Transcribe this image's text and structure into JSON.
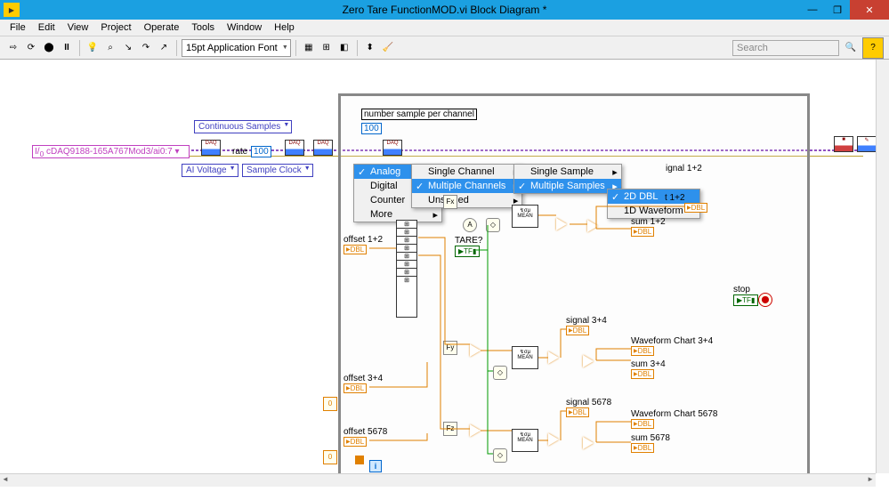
{
  "window": {
    "title": "Zero Tare FunctionMOD.vi Block Diagram *",
    "minimize": "—",
    "maximize": "❐",
    "close": "✕"
  },
  "menu": [
    "File",
    "Edit",
    "View",
    "Project",
    "Operate",
    "Tools",
    "Window",
    "Help"
  ],
  "toolbar": {
    "font_label": "15pt Application Font",
    "search_placeholder": "Search"
  },
  "diagram": {
    "device_path": "cDAQ9188-165A767Mod3/ai0:7",
    "continuous_samples": "Continuous Samples",
    "ai_voltage": "AI Voltage",
    "sample_clock": "Sample Clock",
    "rate_label": "rate",
    "rate_value": "100",
    "num_samples_label": "number sample per channel",
    "num_samples_value": "100",
    "tare_label": "TARE?",
    "tare_val": "TF",
    "stop_label": "stop",
    "stop_val": "TF",
    "fx": "Fx",
    "fy": "Fy",
    "fz": "Fz",
    "mean": "MEAN",
    "i_terminal": "i",
    "shift_zero": "0",
    "offsets": {
      "o12": "offset 1+2",
      "o34": "offset 3+4",
      "o5678": "offset 5678"
    },
    "signals": {
      "s12": "ignal 1+2",
      "s34": "signal 3+4",
      "s5678": "signal 5678"
    },
    "sums": {
      "sum12": "sum 1+2",
      "sum34": "sum 3+4",
      "sum5678": "sum 5678"
    },
    "charts": {
      "c12": "t 1+2",
      "c34": "Waveform Chart 3+4",
      "c5678": "Waveform Chart 5678"
    },
    "dbl": "DBL",
    "daq": "DAQ"
  },
  "context_menu": {
    "col1": [
      {
        "label": "Analog",
        "arrow": true,
        "sel": true,
        "check": true
      },
      {
        "label": "Digital",
        "arrow": true
      },
      {
        "label": "Counter",
        "arrow": true
      },
      {
        "label": "More",
        "arrow": true
      }
    ],
    "col2": [
      {
        "label": "Single Channel",
        "arrow": true
      },
      {
        "label": "Multiple Channels",
        "arrow": true,
        "sel": true,
        "check": true
      },
      {
        "label": "Unscaled",
        "arrow": true
      }
    ],
    "col3": [
      {
        "label": "Single Sample",
        "arrow": true
      },
      {
        "label": "Multiple Samples",
        "arrow": true,
        "sel": true,
        "check": true
      }
    ],
    "col4": [
      {
        "label": "2D DBL",
        "sel": true,
        "check": true
      },
      {
        "label": "1D Waveform"
      }
    ]
  }
}
